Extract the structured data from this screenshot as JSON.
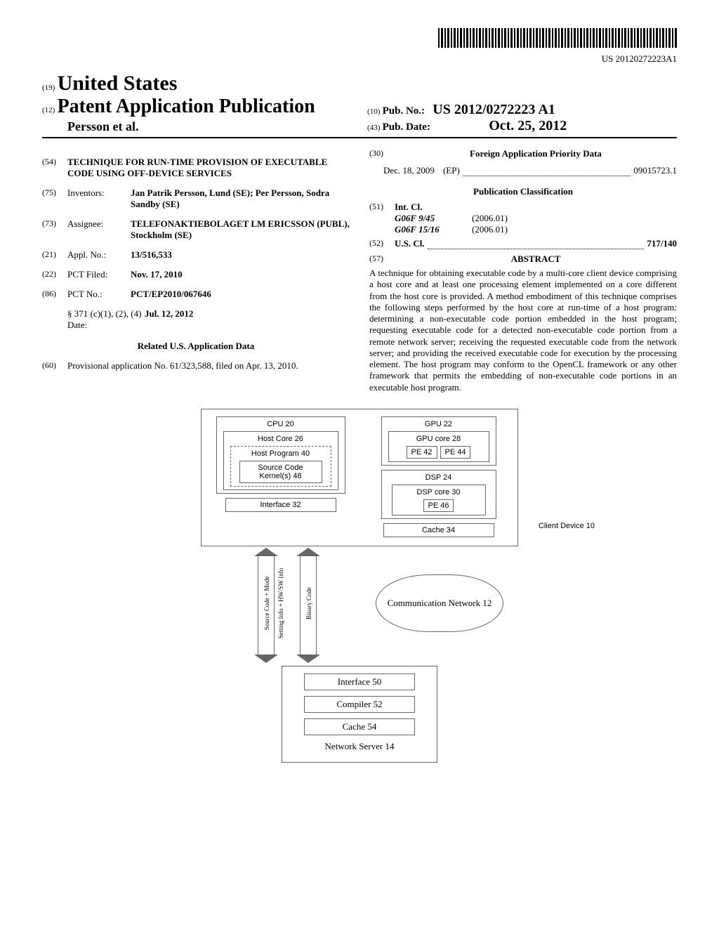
{
  "barcode_docnum": "US 20120272223A1",
  "header": {
    "country_code": "(19)",
    "country": "United States",
    "pubtype_code": "(12)",
    "pubtype": "Patent Application Publication",
    "applicant": "Persson et al.",
    "pubno_code": "(10)",
    "pubno_label": "Pub. No.:",
    "pubno": "US 2012/0272223 A1",
    "pubdate_code": "(43)",
    "pubdate_label": "Pub. Date:",
    "pubdate": "Oct. 25, 2012"
  },
  "left": {
    "title_code": "(54)",
    "title": "TECHNIQUE FOR RUN-TIME PROVISION OF EXECUTABLE CODE USING OFF-DEVICE SERVICES",
    "inventors_code": "(75)",
    "inventors_label": "Inventors:",
    "inventors": "Jan Patrik Persson, Lund (SE); Per Persson, Sodra Sandby (SE)",
    "assignee_code": "(73)",
    "assignee_label": "Assignee:",
    "assignee": "TELEFONAKTIEBOLAGET LM ERICSSON (PUBL), Stockholm (SE)",
    "applno_code": "(21)",
    "applno_label": "Appl. No.:",
    "applno": "13/516,533",
    "pctfiled_code": "(22)",
    "pctfiled_label": "PCT Filed:",
    "pctfiled": "Nov. 17, 2010",
    "pctno_code": "(86)",
    "pctno_label": "PCT No.:",
    "pctno": "PCT/EP2010/067646",
    "s371_label": "§ 371 (c)(1), (2), (4) Date:",
    "s371_date": "Jul. 12, 2012",
    "related_heading": "Related U.S. Application Data",
    "provisional_code": "(60)",
    "provisional_text": "Provisional application No. 61/323,588, filed on Apr. 13, 2010."
  },
  "right": {
    "foreign_code": "(30)",
    "foreign_heading": "Foreign Application Priority Data",
    "foreign_date": "Dec. 18, 2009",
    "foreign_country": "(EP)",
    "foreign_num": "09015723.1",
    "pubclass_heading": "Publication Classification",
    "intcl_code": "(51)",
    "intcl_label": "Int. Cl.",
    "intcl_1": "G06F 9/45",
    "intcl_1_ver": "(2006.01)",
    "intcl_2": "G06F 15/16",
    "intcl_2_ver": "(2006.01)",
    "uscl_code": "(52)",
    "uscl_label": "U.S. Cl.",
    "uscl_value": "717/140",
    "abstract_code": "(57)",
    "abstract_heading": "ABSTRACT",
    "abstract_text": "A technique for obtaining executable code by a multi-core client device comprising a host core and at least one processing element implemented on a core different from the host core is provided. A method embodiment of this technique comprises the following steps performed by the host core at run-time of a host program: determining a non-executable code portion embedded in the host program; requesting executable code for a detected non-executable code portion from a remote network server; receiving the requested executable code from the network server; and providing the received executable code for execution by the processing element. The host program may conform to the OpenCL framework or any other framework that permits the embedding of non-executable code portions in an executable host program."
  },
  "figure": {
    "cpu": "CPU 20",
    "gpu": "GPU 22",
    "host_core": "Host Core 26",
    "gpu_core": "GPU core 28",
    "pe42": "PE 42",
    "pe44": "PE 44",
    "host_program": "Host Program 40",
    "source_kernel": "Source Code Kernel(s) 48",
    "dsp": "DSP 24",
    "dsp_core": "DSP core 30",
    "pe46": "PE 46",
    "interface32": "Interface 32",
    "cache34": "Cache 34",
    "client_device": "Client Device 10",
    "arrow1_a": "Source Code + Mode",
    "arrow1_b": "Setting Info + HW/SW Info",
    "arrow2": "Binary Code",
    "comm_net": "Communication Network 12",
    "interface50": "Interface 50",
    "compiler52": "Compiler 52",
    "cache54": "Cache 54",
    "network_server": "Network Server 14"
  }
}
